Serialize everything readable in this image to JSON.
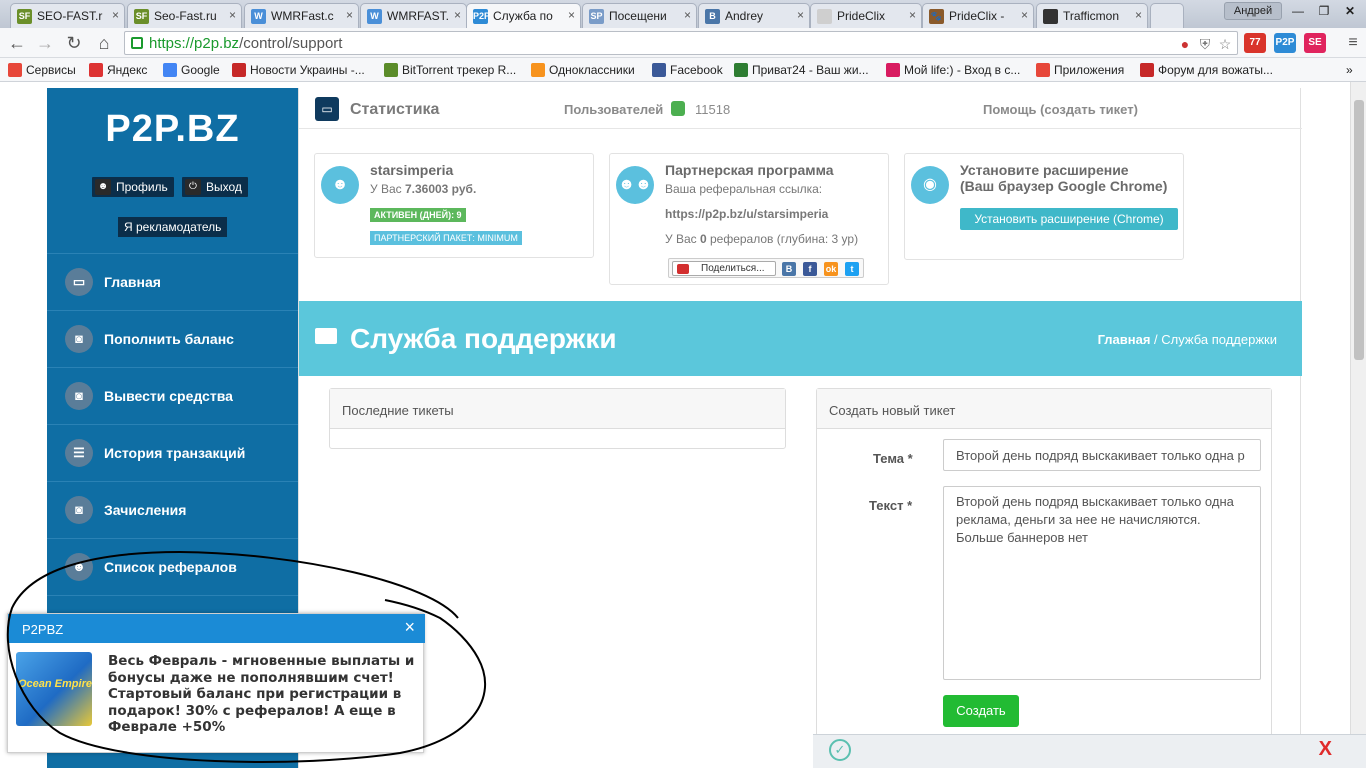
{
  "browser": {
    "tabs": [
      {
        "label": "SEO-FAST.r",
        "fav": "SF",
        "color": "#6b8f2a"
      },
      {
        "label": "Seo-Fast.ru",
        "fav": "SF",
        "color": "#6b8f2a"
      },
      {
        "label": "WMRFast.c",
        "fav": "W",
        "color": "#4a8fd8"
      },
      {
        "label": "WMRFAST.",
        "fav": "W",
        "color": "#4a8fd8"
      },
      {
        "label": "Служба по",
        "fav": "P2P",
        "color": "#2e8bd6"
      },
      {
        "label": "Посещени",
        "fav": "SP",
        "color": "#7a9cc8"
      },
      {
        "label": "Andrey",
        "fav": "B",
        "color": "#4a76a8"
      },
      {
        "label": "PrideClix",
        "fav": "",
        "color": "#cfcfcf"
      },
      {
        "label": "PrideClix -",
        "fav": "🐾",
        "color": "#8a5a2b"
      },
      {
        "label": "Trafficmon",
        "fav": "",
        "color": "#333333"
      }
    ],
    "user_label": "Андрей",
    "url_host": "https://p2p.bz",
    "url_path": "/control/support",
    "extensions": [
      {
        "label": "77",
        "color": "#d9342b"
      },
      {
        "label": "P2P",
        "color": "#2e8bd6"
      },
      {
        "label": "SE",
        "color": "#e0245e"
      }
    ],
    "bookmarks": [
      {
        "label": "Сервисы",
        "color": "#e7473a"
      },
      {
        "label": "Яндекс",
        "color": "#d33"
      },
      {
        "label": "Google",
        "color": "#4285f4"
      },
      {
        "label": "Новости Украины -...",
        "color": "#c62828"
      },
      {
        "label": "BitTorrent трекер R...",
        "color": "#5b8c2a"
      },
      {
        "label": "Одноклассники",
        "color": "#f7931e"
      },
      {
        "label": "Facebook",
        "color": "#3b5998"
      },
      {
        "label": "Приват24 - Ваш жи...",
        "color": "#2e7d32"
      },
      {
        "label": "Мой life:) - Вход в с...",
        "color": "#d81b60"
      },
      {
        "label": "Приложения",
        "color": "#e7473a"
      },
      {
        "label": "Форум для вожаты...",
        "color": "#c62828"
      }
    ]
  },
  "sidebar": {
    "logo": "P2P.BZ",
    "profile_label": "Профиль",
    "logout_label": "Выход",
    "advertiser_label": "Я рекламодатель",
    "menu": [
      {
        "label": "Главная",
        "icon": "monitor-icon",
        "glyph": "▭"
      },
      {
        "label": "Пополнить баланс",
        "icon": "money-icon",
        "glyph": "◙"
      },
      {
        "label": "Вывести средства",
        "icon": "money-icon",
        "glyph": "◙"
      },
      {
        "label": "История транзакций",
        "icon": "list-icon",
        "glyph": "☰"
      },
      {
        "label": "Зачисления",
        "icon": "money-icon",
        "glyph": "◙"
      },
      {
        "label": "Список рефералов",
        "icon": "users-icon",
        "glyph": "☻"
      }
    ]
  },
  "topbar": {
    "title": "Статистика",
    "users_label": "Пользователей",
    "users_count": "11518",
    "help_link": "Помощь (создать тикет)"
  },
  "cards": {
    "user": {
      "name": "starsimperia",
      "balance_prefix": "У Вас ",
      "balance_value": "7.36003 руб.",
      "active_badge": "АКТИВЕН (ДНЕЙ): 9",
      "package_badge": "ПАРТНЕРСКИЙ ПАКЕТ: MINIMUM"
    },
    "partner": {
      "title": "Партнерская программа",
      "ref_label": "Ваша реферальная ссылка:",
      "ref_link": "https://p2p.bz/u/starsimperia",
      "ref_prefix": "У Вас ",
      "ref_count": "0",
      "ref_suffix": " рефералов (глубина: 3 ур)",
      "share_label": "Поделиться...",
      "social": [
        {
          "label": "В",
          "color": "#4a76a8"
        },
        {
          "label": "f",
          "color": "#3b5998"
        },
        {
          "label": "ok",
          "color": "#f7931e"
        },
        {
          "label": "t",
          "color": "#1da1f2"
        }
      ]
    },
    "extension": {
      "title_line1": "Установите расширение",
      "title_line2": "(Ваш браузер Google Chrome)",
      "button": "Установить расширение (Chrome)"
    }
  },
  "banner": {
    "title": "Служба поддержки",
    "breadcrumb_home": "Главная",
    "breadcrumb_sep": " / ",
    "breadcrumb_current": "Служба поддержки"
  },
  "tickets": {
    "heading": "Последние тикеты"
  },
  "new_ticket": {
    "heading": "Создать новый тикет",
    "subject_label": "Тема *",
    "subject_value": "Второй день подряд выскакивает только одна р",
    "text_label": "Текст *",
    "text_value": "Второй день подряд выскакивает только одна\nреклама, деньги за нее не начисляются.\nБольше баннеров нет",
    "submit": "Создать"
  },
  "popup": {
    "title": "P2PBZ",
    "close": "×",
    "image_label": "Ocean Empire",
    "text": "Весь Февраль - мгновенные выплаты и бонусы даже не пополнявшим счет! Стартовый баланс при регистрации в подарок! 30% с рефералов! А еще в Феврале +50%"
  },
  "notification": {
    "check": "✓",
    "close": "X"
  }
}
